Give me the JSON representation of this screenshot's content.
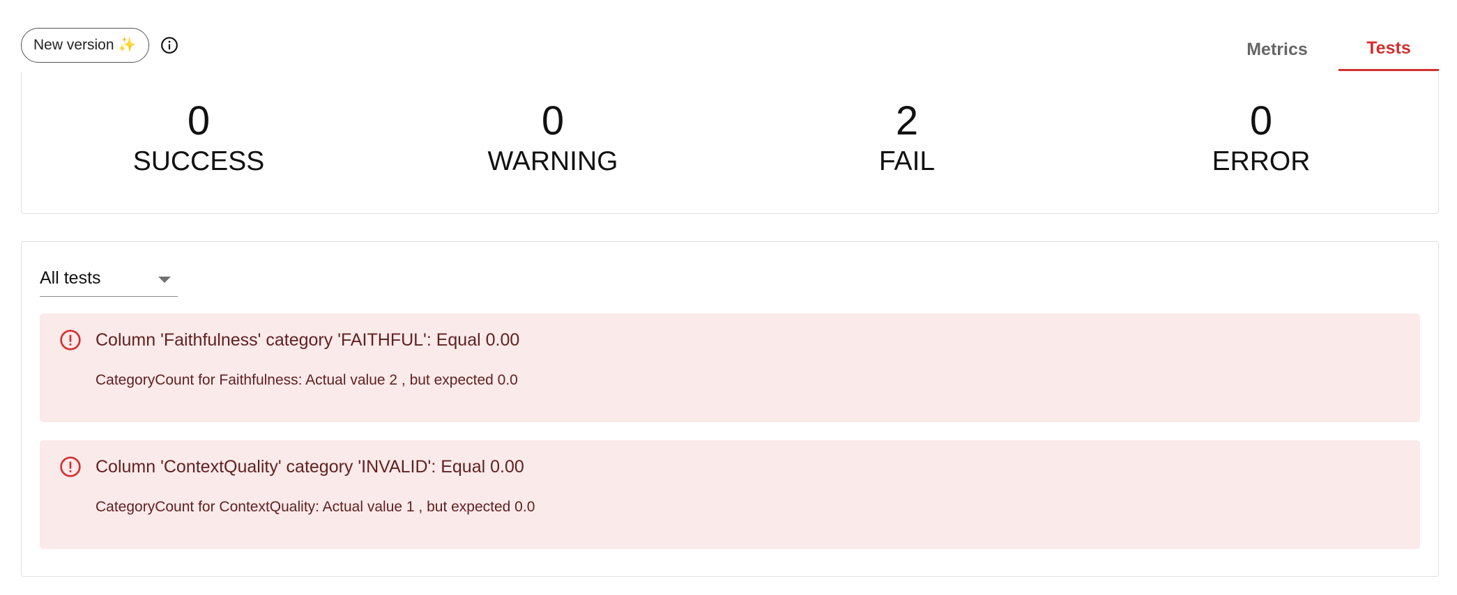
{
  "toolbar": {
    "new_version_label": "New version ✨",
    "info_icon": "info-icon"
  },
  "tabs": [
    {
      "label": "Metrics",
      "active": false
    },
    {
      "label": "Tests",
      "active": true
    }
  ],
  "summary": [
    {
      "count": "0",
      "label": "SUCCESS"
    },
    {
      "count": "0",
      "label": "WARNING"
    },
    {
      "count": "2",
      "label": "FAIL"
    },
    {
      "count": "0",
      "label": "ERROR"
    }
  ],
  "filter": {
    "selected": "All tests"
  },
  "alerts": [
    {
      "icon": "error-outline-icon",
      "title": "Column 'Faithfulness' category 'FAITHFUL': Equal 0.00",
      "message": "CategoryCount for Faithfulness: Actual value 2 , but expected 0.0"
    },
    {
      "icon": "error-outline-icon",
      "title": "Column 'ContextQuality' category 'INVALID': Equal 0.00",
      "message": "CategoryCount for ContextQuality: Actual value 1 , but expected 0.0"
    }
  ],
  "colors": {
    "accent": "#d32f2f",
    "alert_bg": "#fbeaea",
    "alert_text": "#5f2120",
    "tab_inactive": "#666666"
  }
}
